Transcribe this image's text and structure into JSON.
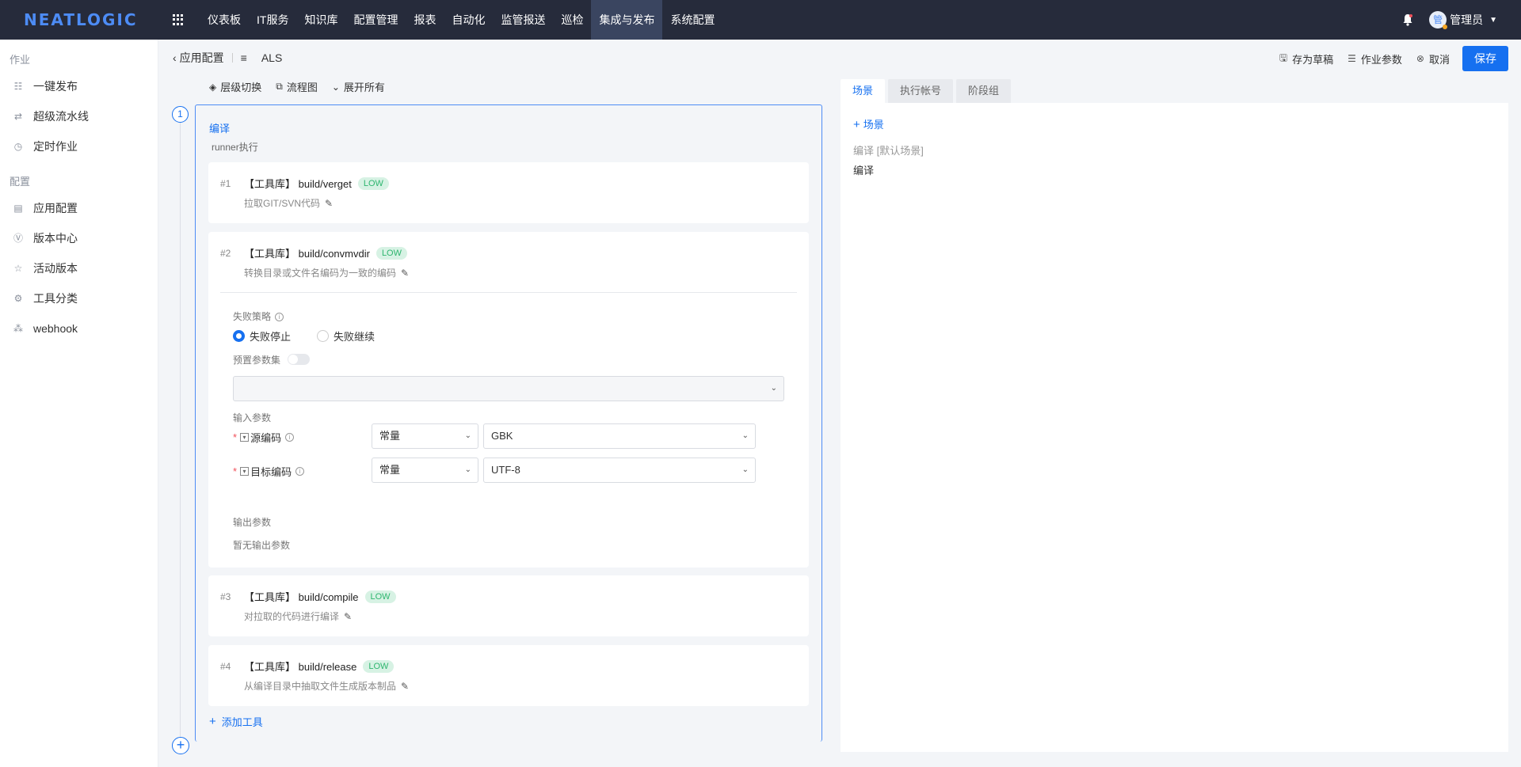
{
  "brand": {
    "logo": "NEATLOGIC"
  },
  "topnav": {
    "items": [
      {
        "label": "仪表板"
      },
      {
        "label": "IT服务"
      },
      {
        "label": "知识库"
      },
      {
        "label": "配置管理"
      },
      {
        "label": "报表"
      },
      {
        "label": "自动化"
      },
      {
        "label": "监管报送"
      },
      {
        "label": "巡检"
      },
      {
        "label": "集成与发布",
        "active": true
      },
      {
        "label": "系统配置"
      }
    ],
    "user": {
      "avatar_text": "管",
      "name": "管理员"
    }
  },
  "sidebar": {
    "groups": [
      {
        "title": "作业",
        "items": [
          {
            "label": "一键发布",
            "icon": "publish-icon"
          },
          {
            "label": "超级流水线",
            "icon": "pipeline-icon"
          },
          {
            "label": "定时作业",
            "icon": "clock-icon"
          }
        ]
      },
      {
        "title": "配置",
        "items": [
          {
            "label": "应用配置",
            "icon": "document-icon"
          },
          {
            "label": "版本中心",
            "icon": "version-icon"
          },
          {
            "label": "活动版本",
            "icon": "star-icon"
          },
          {
            "label": "工具分类",
            "icon": "gear-icon"
          },
          {
            "label": "webhook",
            "icon": "webhook-icon"
          }
        ]
      }
    ]
  },
  "breadcrumb": {
    "back_label": "应用配置",
    "current": "ALS"
  },
  "header_actions": {
    "save_draft": "存为草稿",
    "job_params": "作业参数",
    "cancel": "取消",
    "save": "保存"
  },
  "toolbar": {
    "level_switch": "层级切换",
    "flowchart": "流程图",
    "expand_all": "展开所有"
  },
  "phase": {
    "number": "1",
    "title": "编译",
    "subtitle": "runner执行",
    "add_tool": "添加工具",
    "tools": [
      {
        "idx": "#1",
        "name": "【工具库】 build/verget",
        "badge": "LOW",
        "desc": "拉取GIT/SVN代码"
      },
      {
        "idx": "#2",
        "name": "【工具库】 build/convmvdir",
        "badge": "LOW",
        "desc": "转换目录或文件名编码为一致的编码"
      },
      {
        "idx": "#3",
        "name": "【工具库】 build/compile",
        "badge": "LOW",
        "desc": "对拉取的代码进行编译"
      },
      {
        "idx": "#4",
        "name": "【工具库】 build/release",
        "badge": "LOW",
        "desc": "从编译目录中抽取文件生成版本制品"
      }
    ],
    "detail": {
      "fail_policy_label": "失败策略",
      "fail_stop": "失败停止",
      "fail_continue": "失败继续",
      "preset_params_label": "预置参数集",
      "preset_select_value": "",
      "input_params_label": "输入参数",
      "inputs": [
        {
          "name": "源编码",
          "type": "常量",
          "value": "GBK"
        },
        {
          "name": "目标编码",
          "type": "常量",
          "value": "UTF-8"
        }
      ],
      "output_params_label": "输出参数",
      "no_output": "暂无输出参数"
    }
  },
  "right_panel": {
    "tabs": [
      {
        "label": "场景",
        "active": true
      },
      {
        "label": "执行帐号"
      },
      {
        "label": "阶段组"
      }
    ],
    "add_scene": "场景",
    "scene_header": "编译 [默认场景]",
    "scene_item": "编译"
  },
  "colors": {
    "accent": "#1670f0",
    "nav_bg": "#262b3b",
    "badge_low": "#2eb66f"
  }
}
